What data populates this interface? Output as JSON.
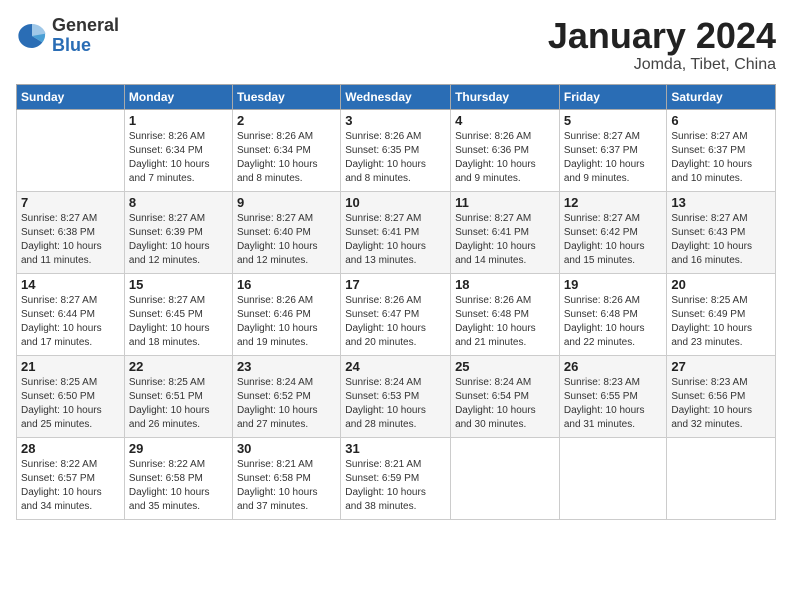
{
  "logo": {
    "general": "General",
    "blue": "Blue"
  },
  "title": "January 2024",
  "location": "Jomda, Tibet, China",
  "weekdays": [
    "Sunday",
    "Monday",
    "Tuesday",
    "Wednesday",
    "Thursday",
    "Friday",
    "Saturday"
  ],
  "weeks": [
    [
      {
        "day": "",
        "info": ""
      },
      {
        "day": "1",
        "info": "Sunrise: 8:26 AM\nSunset: 6:34 PM\nDaylight: 10 hours\nand 7 minutes."
      },
      {
        "day": "2",
        "info": "Sunrise: 8:26 AM\nSunset: 6:34 PM\nDaylight: 10 hours\nand 8 minutes."
      },
      {
        "day": "3",
        "info": "Sunrise: 8:26 AM\nSunset: 6:35 PM\nDaylight: 10 hours\nand 8 minutes."
      },
      {
        "day": "4",
        "info": "Sunrise: 8:26 AM\nSunset: 6:36 PM\nDaylight: 10 hours\nand 9 minutes."
      },
      {
        "day": "5",
        "info": "Sunrise: 8:27 AM\nSunset: 6:37 PM\nDaylight: 10 hours\nand 9 minutes."
      },
      {
        "day": "6",
        "info": "Sunrise: 8:27 AM\nSunset: 6:37 PM\nDaylight: 10 hours\nand 10 minutes."
      }
    ],
    [
      {
        "day": "7",
        "info": "Sunrise: 8:27 AM\nSunset: 6:38 PM\nDaylight: 10 hours\nand 11 minutes."
      },
      {
        "day": "8",
        "info": "Sunrise: 8:27 AM\nSunset: 6:39 PM\nDaylight: 10 hours\nand 12 minutes."
      },
      {
        "day": "9",
        "info": "Sunrise: 8:27 AM\nSunset: 6:40 PM\nDaylight: 10 hours\nand 12 minutes."
      },
      {
        "day": "10",
        "info": "Sunrise: 8:27 AM\nSunset: 6:41 PM\nDaylight: 10 hours\nand 13 minutes."
      },
      {
        "day": "11",
        "info": "Sunrise: 8:27 AM\nSunset: 6:41 PM\nDaylight: 10 hours\nand 14 minutes."
      },
      {
        "day": "12",
        "info": "Sunrise: 8:27 AM\nSunset: 6:42 PM\nDaylight: 10 hours\nand 15 minutes."
      },
      {
        "day": "13",
        "info": "Sunrise: 8:27 AM\nSunset: 6:43 PM\nDaylight: 10 hours\nand 16 minutes."
      }
    ],
    [
      {
        "day": "14",
        "info": "Sunrise: 8:27 AM\nSunset: 6:44 PM\nDaylight: 10 hours\nand 17 minutes."
      },
      {
        "day": "15",
        "info": "Sunrise: 8:27 AM\nSunset: 6:45 PM\nDaylight: 10 hours\nand 18 minutes."
      },
      {
        "day": "16",
        "info": "Sunrise: 8:26 AM\nSunset: 6:46 PM\nDaylight: 10 hours\nand 19 minutes."
      },
      {
        "day": "17",
        "info": "Sunrise: 8:26 AM\nSunset: 6:47 PM\nDaylight: 10 hours\nand 20 minutes."
      },
      {
        "day": "18",
        "info": "Sunrise: 8:26 AM\nSunset: 6:48 PM\nDaylight: 10 hours\nand 21 minutes."
      },
      {
        "day": "19",
        "info": "Sunrise: 8:26 AM\nSunset: 6:48 PM\nDaylight: 10 hours\nand 22 minutes."
      },
      {
        "day": "20",
        "info": "Sunrise: 8:25 AM\nSunset: 6:49 PM\nDaylight: 10 hours\nand 23 minutes."
      }
    ],
    [
      {
        "day": "21",
        "info": "Sunrise: 8:25 AM\nSunset: 6:50 PM\nDaylight: 10 hours\nand 25 minutes."
      },
      {
        "day": "22",
        "info": "Sunrise: 8:25 AM\nSunset: 6:51 PM\nDaylight: 10 hours\nand 26 minutes."
      },
      {
        "day": "23",
        "info": "Sunrise: 8:24 AM\nSunset: 6:52 PM\nDaylight: 10 hours\nand 27 minutes."
      },
      {
        "day": "24",
        "info": "Sunrise: 8:24 AM\nSunset: 6:53 PM\nDaylight: 10 hours\nand 28 minutes."
      },
      {
        "day": "25",
        "info": "Sunrise: 8:24 AM\nSunset: 6:54 PM\nDaylight: 10 hours\nand 30 minutes."
      },
      {
        "day": "26",
        "info": "Sunrise: 8:23 AM\nSunset: 6:55 PM\nDaylight: 10 hours\nand 31 minutes."
      },
      {
        "day": "27",
        "info": "Sunrise: 8:23 AM\nSunset: 6:56 PM\nDaylight: 10 hours\nand 32 minutes."
      }
    ],
    [
      {
        "day": "28",
        "info": "Sunrise: 8:22 AM\nSunset: 6:57 PM\nDaylight: 10 hours\nand 34 minutes."
      },
      {
        "day": "29",
        "info": "Sunrise: 8:22 AM\nSunset: 6:58 PM\nDaylight: 10 hours\nand 35 minutes."
      },
      {
        "day": "30",
        "info": "Sunrise: 8:21 AM\nSunset: 6:58 PM\nDaylight: 10 hours\nand 37 minutes."
      },
      {
        "day": "31",
        "info": "Sunrise: 8:21 AM\nSunset: 6:59 PM\nDaylight: 10 hours\nand 38 minutes."
      },
      {
        "day": "",
        "info": ""
      },
      {
        "day": "",
        "info": ""
      },
      {
        "day": "",
        "info": ""
      }
    ]
  ]
}
